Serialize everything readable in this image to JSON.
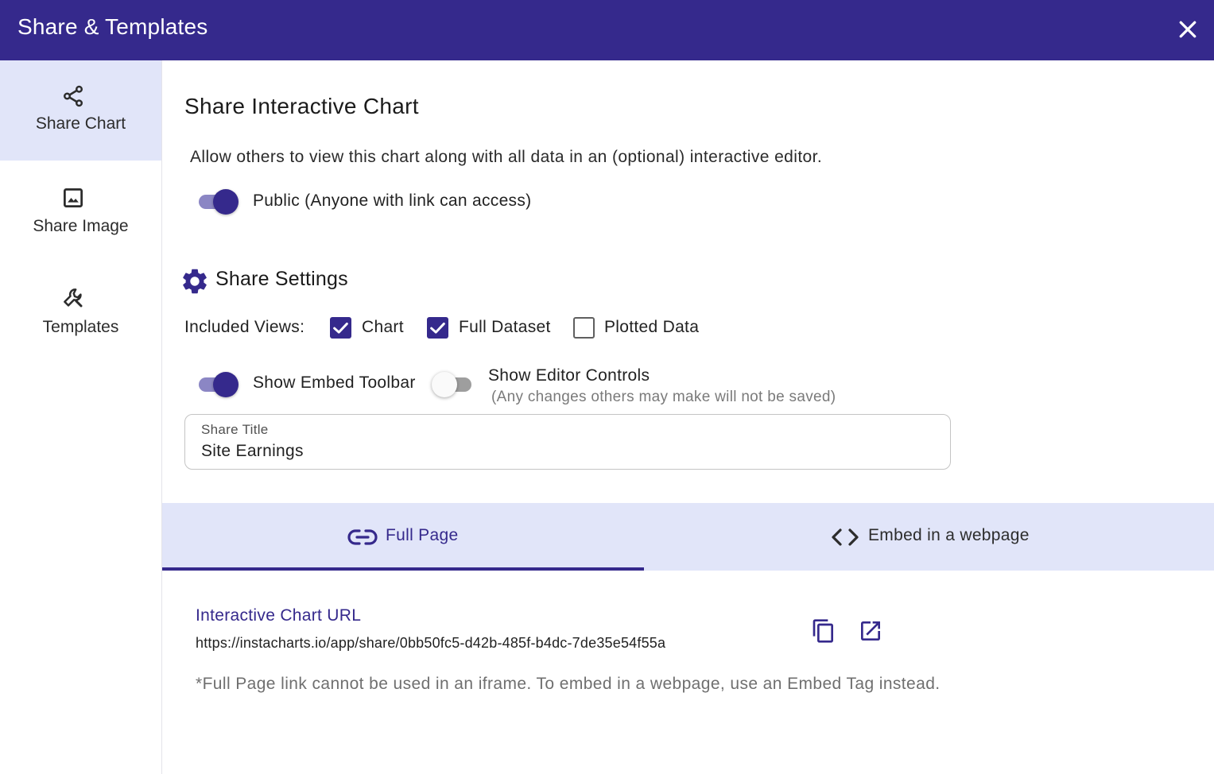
{
  "dialog": {
    "title": "Share & Templates",
    "close_icon": "close-icon"
  },
  "sidebar": {
    "items": [
      {
        "label": "Share Chart",
        "icon": "share-icon",
        "active": true
      },
      {
        "label": "Share Image",
        "icon": "image-icon",
        "active": false
      },
      {
        "label": "Templates",
        "icon": "wrench-icon",
        "active": false
      }
    ]
  },
  "main": {
    "title": "Share Interactive Chart",
    "description": "Allow others to view this chart along with all data in an (optional) interactive editor.",
    "public_toggle": {
      "label": "Public (Anyone with link can access)",
      "on": true
    }
  },
  "share_settings": {
    "title": "Share Settings",
    "icon": "gear-icon",
    "included_views_label": "Included Views:",
    "views": [
      {
        "label": "Chart",
        "checked": true
      },
      {
        "label": "Full Dataset",
        "checked": true
      },
      {
        "label": "Plotted Data",
        "checked": false
      }
    ],
    "embed_toolbar": {
      "label": "Show Embed Toolbar",
      "on": true
    },
    "editor_controls": {
      "label": "Show Editor Controls",
      "note": "(Any changes others may make will not be saved)",
      "on": false
    },
    "share_title": {
      "label": "Share Title",
      "value": "Site Earnings"
    }
  },
  "tabs": [
    {
      "label": "Full Page",
      "icon": "link-icon",
      "active": true
    },
    {
      "label": "Embed in a webpage",
      "icon": "code-icon",
      "active": false
    }
  ],
  "full_page": {
    "url_label": "Interactive Chart URL",
    "url": "https://instacharts.io/app/share/0bb50fc5-d42b-485f-b4dc-7de35e54f55a",
    "note": "*Full Page link cannot be used in an iframe. To embed in a webpage, use an Embed Tag instead."
  },
  "colors": {
    "primary": "#35298c",
    "tab_background": "#e1e5f9"
  }
}
